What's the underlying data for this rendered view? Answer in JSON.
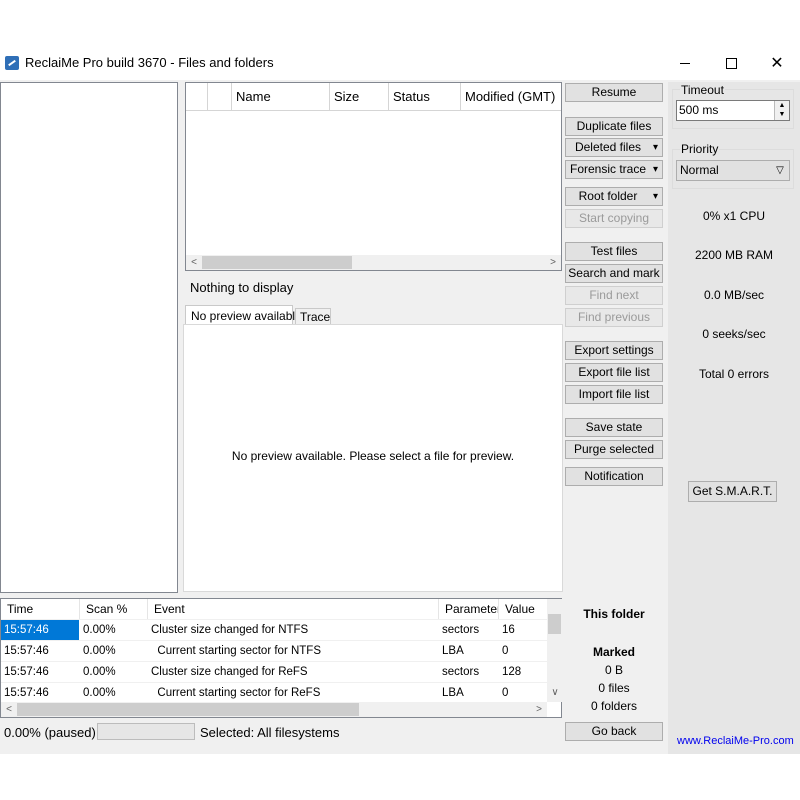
{
  "window": {
    "title": "ReclaiMe Pro build 3670 - Files and folders",
    "controls": {
      "minimize": "",
      "maximize": "",
      "close": "✕"
    }
  },
  "file_list": {
    "columns": [
      "",
      "",
      "Name",
      "Size",
      "Status",
      "Modified (GMT)"
    ],
    "empty_text": "Nothing to display"
  },
  "tabs": [
    {
      "label": "No preview available",
      "active": true
    },
    {
      "label": "Trace",
      "active": false
    }
  ],
  "preview": {
    "message": "No preview available. Please select a file for preview."
  },
  "buttons": {
    "resume": "Resume",
    "duplicate_files": "Duplicate files",
    "deleted_files": "Deleted files",
    "forensic_trace": "Forensic trace",
    "root_folder": "Root folder",
    "start_copying": "Start copying",
    "test_files": "Test files",
    "search_and_mark": "Search and mark",
    "find_next": "Find next",
    "find_previous": "Find previous",
    "export_settings": "Export settings",
    "export_file_list": "Export file list",
    "import_file_list": "Import file list",
    "save_state": "Save state",
    "purge_selected": "Purge selected",
    "notification": "Notification",
    "go_back": "Go back"
  },
  "timeout": {
    "label": "Timeout",
    "value": "500 ms"
  },
  "priority": {
    "label": "Priority",
    "value": "Normal"
  },
  "stats": {
    "cpu": "0% x1 CPU",
    "ram": "2200 MB RAM",
    "speed": "0.0 MB/sec",
    "seeks": "0 seeks/sec",
    "errors": "Total 0 errors"
  },
  "smart_button": "Get S.M.A.R.T.",
  "site_link": "www.ReclaiMe-Pro.com",
  "log": {
    "columns": [
      "Time",
      "Scan %",
      "Event",
      "Parameter",
      "Value"
    ],
    "rows": [
      {
        "time": "15:57:46",
        "scan": "0.00%",
        "event": "Cluster size changed for NTFS",
        "parameter": "sectors",
        "value": "16"
      },
      {
        "time": "15:57:46",
        "scan": "0.00%",
        "event": "  Current starting sector for NTFS",
        "parameter": "LBA",
        "value": "0"
      },
      {
        "time": "15:57:46",
        "scan": "0.00%",
        "event": "Cluster size changed for ReFS",
        "parameter": "sectors",
        "value": "128"
      },
      {
        "time": "15:57:46",
        "scan": "0.00%",
        "event": "  Current starting sector for ReFS",
        "parameter": "LBA",
        "value": "0"
      }
    ]
  },
  "summary": {
    "this_folder": "This folder",
    "marked": "Marked",
    "size": "0 B",
    "files": "0 files",
    "folders": "0 folders"
  },
  "status": {
    "progress_text": "0.00% (paused)",
    "progress": 0.0,
    "filesystems": "Selected: All filesystems"
  },
  "colors": {
    "selection": "#0078d7",
    "link": "#0000ee",
    "window_bg": "#f0f0f0"
  }
}
